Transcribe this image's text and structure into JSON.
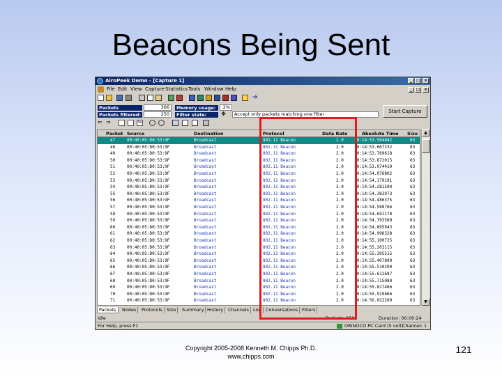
{
  "slide": {
    "title": "Beacons Being Sent",
    "footer_line1": "Copyright 2005-2008 Kenneth M. Chipps Ph.D.",
    "footer_line2": "www.chipps.com",
    "page_number": "121"
  },
  "window": {
    "title": "AiroPeek Demo - [Capture 1]",
    "menu": [
      "File",
      "Edit",
      "View",
      "Capture",
      "Statistics",
      "Tools",
      "Window",
      "Help"
    ]
  },
  "stats": {
    "packets_received_label": "Packets received:",
    "packets_received_value": "366",
    "packets_filtered_label": "Packets filtered:",
    "packets_filtered_value": "250",
    "memory_usage_label": "Memory usage:",
    "memory_usage_value": "2%",
    "filter_state_label": "Filter state:",
    "filter_text": "Accept only packets matching one filter",
    "start_capture_label": "Start Capture"
  },
  "table": {
    "headers": [
      "Packet",
      "Source",
      "Destination",
      "Protocol",
      "Data Rate",
      "Absolute Time",
      "Size"
    ],
    "rows": [
      {
        "packet": "47",
        "source": "00:40:05:D0:53:9F",
        "destination": "Broadcast",
        "protocol": "802.11 Beacon",
        "rate": "2.0",
        "time": "10:14:53.564842",
        "size": "63"
      },
      {
        "packet": "48",
        "source": "00:40:05:D0:53:9F",
        "destination": "Broadcast",
        "protocol": "802.11 Beacon",
        "rate": "2.0",
        "time": "10:14:53.667232",
        "size": "63"
      },
      {
        "packet": "49",
        "source": "00:40:05:D0:53:9F",
        "destination": "Broadcast",
        "protocol": "802.11 Beacon",
        "rate": "2.0",
        "time": "10:14:53.769618",
        "size": "63"
      },
      {
        "packet": "50",
        "source": "00:40:05:D0:53:9F",
        "destination": "Broadcast",
        "protocol": "802.11 Beacon",
        "rate": "2.0",
        "time": "10:14:53.872015",
        "size": "63"
      },
      {
        "packet": "51",
        "source": "00:40:05:D0:53:9F",
        "destination": "Broadcast",
        "protocol": "802.11 Beacon",
        "rate": "2.0",
        "time": "10:14:53.974410",
        "size": "63"
      },
      {
        "packet": "52",
        "source": "00:40:05:D0:53:9F",
        "destination": "Broadcast",
        "protocol": "802.11 Beacon",
        "rate": "2.0",
        "time": "10:14:54.076802",
        "size": "63"
      },
      {
        "packet": "53",
        "source": "00:40:05:D0:53:9F",
        "destination": "Broadcast",
        "protocol": "802.11 Beacon",
        "rate": "2.0",
        "time": "10:14:54.179191",
        "size": "63"
      },
      {
        "packet": "54",
        "source": "00:40:05:D0:53:9F",
        "destination": "Broadcast",
        "protocol": "802.11 Beacon",
        "rate": "2.0",
        "time": "10:14:54.281590",
        "size": "63"
      },
      {
        "packet": "55",
        "source": "00:40:05:D0:53:9F",
        "destination": "Broadcast",
        "protocol": "802.11 Beacon",
        "rate": "2.0",
        "time": "10:14:54.383973",
        "size": "63"
      },
      {
        "packet": "56",
        "source": "00:40:05:D0:53:9F",
        "destination": "Broadcast",
        "protocol": "802.11 Beacon",
        "rate": "2.0",
        "time": "10:14:54.486375",
        "size": "63"
      },
      {
        "packet": "57",
        "source": "00:40:05:D0:53:9F",
        "destination": "Broadcast",
        "protocol": "802.11 Beacon",
        "rate": "2.0",
        "time": "10:14:54.588766",
        "size": "63"
      },
      {
        "packet": "58",
        "source": "00:40:05:D0:53:9F",
        "destination": "Broadcast",
        "protocol": "802.11 Beacon",
        "rate": "2.0",
        "time": "10:14:54.691178",
        "size": "63"
      },
      {
        "packet": "59",
        "source": "00:40:05:D0:53:9F",
        "destination": "Broadcast",
        "protocol": "802.11 Beacon",
        "rate": "2.0",
        "time": "10:14:54.793589",
        "size": "63"
      },
      {
        "packet": "60",
        "source": "00:40:05:D0:53:9F",
        "destination": "Broadcast",
        "protocol": "802.11 Beacon",
        "rate": "2.0",
        "time": "10:14:54.895943",
        "size": "63"
      },
      {
        "packet": "61",
        "source": "00:40:05:D0:53:9F",
        "destination": "Broadcast",
        "protocol": "802.11 Beacon",
        "rate": "2.0",
        "time": "10:14:54.998328",
        "size": "63"
      },
      {
        "packet": "62",
        "source": "00:40:05:D0:53:9F",
        "destination": "Broadcast",
        "protocol": "802.11 Beacon",
        "rate": "2.0",
        "time": "10:14:55.100725",
        "size": "63"
      },
      {
        "packet": "63",
        "source": "00:40:05:D0:53:9F",
        "destination": "Broadcast",
        "protocol": "802.11 Beacon",
        "rate": "2.0",
        "time": "10:14:55.203115",
        "size": "63"
      },
      {
        "packet": "64",
        "source": "00:40:05:D0:53:9F",
        "destination": "Broadcast",
        "protocol": "802.11 Beacon",
        "rate": "2.0",
        "time": "10:14:55.305515",
        "size": "63"
      },
      {
        "packet": "65",
        "source": "00:40:05:D0:53:9F",
        "destination": "Broadcast",
        "protocol": "802.11 Beacon",
        "rate": "2.0",
        "time": "10:14:55.407899",
        "size": "63"
      },
      {
        "packet": "66",
        "source": "00:40:05:D0:53:9F",
        "destination": "Broadcast",
        "protocol": "802.11 Beacon",
        "rate": "2.0",
        "time": "10:14:55.510290",
        "size": "63"
      },
      {
        "packet": "67",
        "source": "00:40:05:D0:53:9F",
        "destination": "Broadcast",
        "protocol": "802.11 Beacon",
        "rate": "2.0",
        "time": "10:14:55.612687",
        "size": "63"
      },
      {
        "packet": "68",
        "source": "00:40:05:D0:53:9F",
        "destination": "Broadcast",
        "protocol": "802.11 Beacon",
        "rate": "2.0",
        "time": "10:14:55.715080",
        "size": "63"
      },
      {
        "packet": "69",
        "source": "00:40:05:D0:53:9F",
        "destination": "Broadcast",
        "protocol": "802.11 Beacon",
        "rate": "2.0",
        "time": "10:14:55.817466",
        "size": "63"
      },
      {
        "packet": "70",
        "source": "00:40:05:D0:53:9F",
        "destination": "Broadcast",
        "protocol": "802.11 Beacon",
        "rate": "2.0",
        "time": "10:14:55.919866",
        "size": "63"
      },
      {
        "packet": "71",
        "source": "00:40:05:D0:53:9F",
        "destination": "Broadcast",
        "protocol": "802.11 Beacon",
        "rate": "2.0",
        "time": "10:14:56.022260",
        "size": "63"
      }
    ],
    "selected_row": 0
  },
  "tabs": [
    "Packets",
    "Nodes",
    "Protocols",
    "Size",
    "Summary",
    "History",
    "Channels",
    "Log",
    "Conversations",
    "Filters"
  ],
  "status": {
    "state": "Idle",
    "packets": "Packets: 250",
    "help": "For Help, press F1",
    "card": "ORINOCO PC Card (5 volt)",
    "channel": "Channel: 1",
    "duration": "Duration: 00:00:24"
  },
  "colors": {
    "selected_row": "#0f8a86",
    "highlight_box": "#e11b1b",
    "titlebar": "#0a246a"
  }
}
